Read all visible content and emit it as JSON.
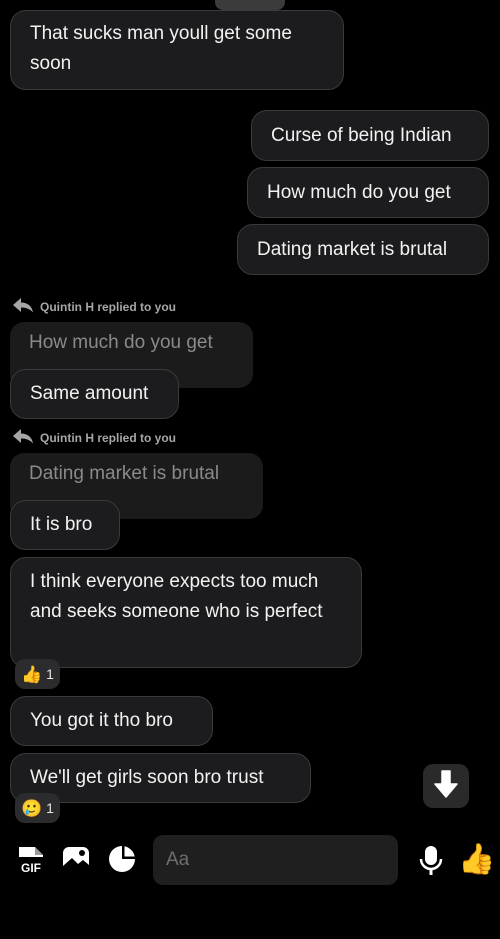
{
  "messages": {
    "m1": "That sucks man youll get some soon",
    "m2": "Curse of being Indian",
    "m3": "How much do you get",
    "m4": "Dating market is brutal",
    "reply1": {
      "label": "Quintin H replied to you",
      "quoted": "How much do you get",
      "text": "Same amount"
    },
    "reply2": {
      "label": "Quintin H replied to you",
      "quoted": "Dating market is brutal",
      "text": "It is bro"
    },
    "m5": "I think everyone expects too much and seeks someone who is perfect",
    "m5_reaction": {
      "emoji": "👍",
      "count": "1"
    },
    "m6": "You got it tho bro",
    "m7": "We'll get girls soon bro trust",
    "m7_reaction": {
      "emoji": "🥲",
      "count": "1"
    }
  },
  "composer": {
    "placeholder": "Aa",
    "gif_label": "GIF",
    "like_emoji": "👍"
  },
  "icons": {
    "reply": "reply-arrow-icon",
    "scroll_down": "arrow-down-icon",
    "gif": "gif-sticker-icon",
    "gallery": "gallery-icon",
    "sticker": "sticker-icon",
    "mic": "microphone-icon",
    "like": "thumbs-up-icon"
  },
  "colors": {
    "background": "#000000",
    "bubble": "#1c1c1e",
    "bubble_border": "#3a3a3c",
    "quoted_text": "#8a8a8a"
  }
}
